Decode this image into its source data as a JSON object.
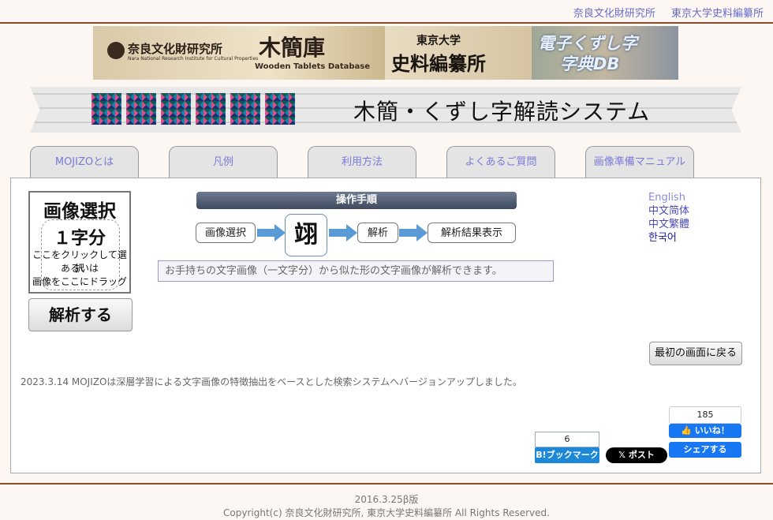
{
  "top_links": [
    "奈良文化財研究所",
    "東京大学史料編纂所"
  ],
  "banner": {
    "nara_name": "奈良文化財研究所",
    "nara_sub": "Nara National Research Institute for Cultural Properties",
    "wooden_title": "木簡庫",
    "wooden_sub": "Wooden Tablets Database",
    "utokyo_line1": "東京大学",
    "utokyo_line2": "史料編纂所",
    "kuzushi_line1": "電子くずし字",
    "kuzushi_line2": "字典DB"
  },
  "mojizo": {
    "logo_text": "MOJIZO",
    "title": "木簡・くずし字解読システム"
  },
  "tabs": [
    "MOJIZOとは",
    "凡例",
    "利用方法",
    "よくあるご質問",
    "画像準備マニュアル"
  ],
  "upload": {
    "title": "画像選択",
    "one_char": "１字分",
    "line1": "ここをクリックして選択",
    "line2": "あるいは",
    "line3": "画像をここにドラッグ",
    "analyze_button": "解析する"
  },
  "procedure": {
    "header": "操作手順",
    "steps": [
      "画像選択",
      "解析",
      "解析結果表示"
    ],
    "sample_char": "翊",
    "description": "お手持ちの文字画像（一文字分）から似た形の文字画像が解析できます。"
  },
  "languages": [
    {
      "label": "English",
      "color": "#8a8ad8"
    },
    {
      "label": "中文简体",
      "color": "#4a4ab8"
    },
    {
      "label": "中文繁體",
      "color": "#4a4ab8"
    },
    {
      "label": "한국어",
      "color": "#1a1aa0"
    }
  ],
  "back_button": "最初の画面に戻る",
  "news": "2023.3.14 MOJIZOは深層学習による文字画像の特徴抽出をベースとした検索システムへバージョンアップしました。",
  "social": {
    "hatena_count": "6",
    "hatena_label": "B!ブックマーク",
    "x_label": "𝕏 ポスト",
    "fb_count": "185",
    "fb_like": "👍 いいね！",
    "fb_share": "シェアする"
  },
  "footer": {
    "version": "2016.3.25β版",
    "copyright": "Copyright(c) 奈良文化財研究所, 東京大学史料編纂所 All Rights Reserved."
  }
}
